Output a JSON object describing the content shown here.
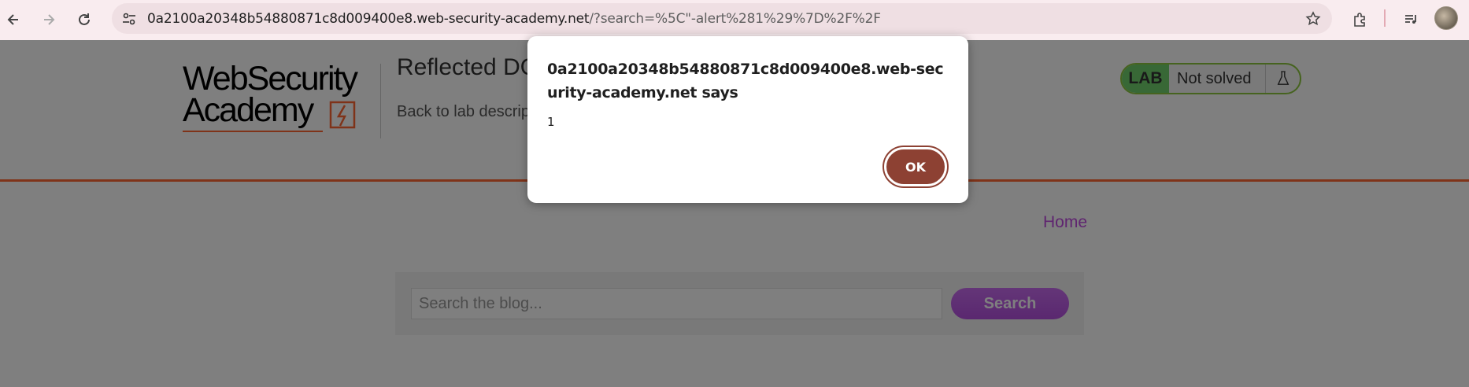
{
  "browser": {
    "url_host": "0a2100a20348b54880871c8d009400e8.web-security-academy.net",
    "url_rest": "/?search=%5C\"-alert%281%29%7D%2F%2F",
    "icons": [
      "back-icon",
      "forward-icon",
      "reload-icon",
      "site-info-icon",
      "bookmark-star-icon",
      "extensions-icon",
      "media-control-icon",
      "profile-avatar"
    ]
  },
  "header": {
    "logo_line1": "WebSecurity",
    "logo_line2": "Academy",
    "lab_title": "Reflected DOM XSS",
    "back_link": "Back to lab description",
    "status_badge": "LAB",
    "status_text": "Not solved"
  },
  "nav": {
    "home": "Home"
  },
  "search": {
    "placeholder": "Search the blog...",
    "button": "Search"
  },
  "dialog": {
    "title": "0a2100a20348b54880871c8d009400e8.web-security-academy.net says",
    "message": "1",
    "ok": "OK"
  },
  "colors": {
    "accent_orange": "#ff6633",
    "status_green": "#70d16d",
    "link_purple": "#bf49e0",
    "ok_button": "#8d4133"
  }
}
